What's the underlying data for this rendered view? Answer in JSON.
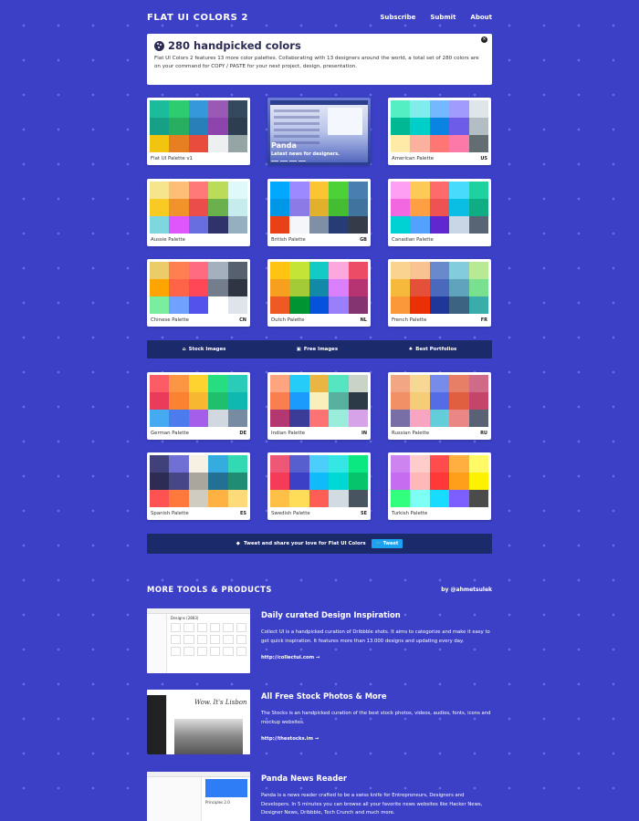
{
  "header": {
    "logo": "FLAT UI COLORS 2",
    "nav": [
      "Subscribe",
      "Submit",
      "About"
    ]
  },
  "intro": {
    "title": "280 handpicked colors",
    "text": "Flat UI Colors 2 features 13 more color palettes. Collaborating with 13 designers around the world, a total set of 280 colors are on your command for COPY / PASTE for your next project, design, presentation.",
    "close": "×"
  },
  "ad": {
    "title": "Panda",
    "subtitle": "Latest news for designers."
  },
  "palettes": [
    {
      "name": "Flat UI Palette v1",
      "flag": "",
      "colors": [
        "#1abc9c",
        "#2ecc71",
        "#3498db",
        "#9b59b6",
        "#34495e",
        "#16a085",
        "#27ae60",
        "#2980b9",
        "#8e44ad",
        "#2c3e50",
        "#f1c40f",
        "#e67e22",
        "#e74c3c",
        "#ecf0f1",
        "#95a5a6"
      ]
    },
    {
      "name": "American Palette",
      "flag": "US",
      "colors": [
        "#55efc4",
        "#81ecec",
        "#74b9ff",
        "#a29bfe",
        "#dfe6e9",
        "#00b894",
        "#00cec9",
        "#0984e3",
        "#6c5ce7",
        "#b2bec3",
        "#ffeaa7",
        "#fab1a0",
        "#ff7675",
        "#fd79a8",
        "#636e72"
      ]
    },
    {
      "name": "Aussie Palette",
      "flag": "",
      "colors": [
        "#f6e58d",
        "#ffbe76",
        "#ff7979",
        "#badc58",
        "#dff9fb",
        "#f9ca24",
        "#f0932b",
        "#eb4d4b",
        "#6ab04c",
        "#c7ecee",
        "#7ed6df",
        "#e056fd",
        "#686de0",
        "#30336b",
        "#95afc0"
      ]
    },
    {
      "name": "British Palette",
      "flag": "GB",
      "colors": [
        "#00a8ff",
        "#9c88ff",
        "#fbc531",
        "#4cd137",
        "#487eb0",
        "#0097e6",
        "#8c7ae6",
        "#e1b12c",
        "#44bd32",
        "#40739e",
        "#e84118",
        "#f5f6fa",
        "#7f8fa6",
        "#273c75",
        "#353b48"
      ]
    },
    {
      "name": "Canadian Palette",
      "flag": "",
      "colors": [
        "#ff9ff3",
        "#feca57",
        "#ff6b6b",
        "#48dbfb",
        "#1dd1a1",
        "#f368e0",
        "#ff9f43",
        "#ee5253",
        "#0abde3",
        "#10ac84",
        "#00d2d3",
        "#54a0ff",
        "#5f27cd",
        "#c8d6e5",
        "#576574"
      ]
    },
    {
      "name": "Chinese Palette",
      "flag": "CN",
      "colors": [
        "#eccc68",
        "#ff7f50",
        "#ff6b81",
        "#a4b0be",
        "#57606f",
        "#ffa502",
        "#ff6348",
        "#ff4757",
        "#747d8c",
        "#2f3542",
        "#7bed9f",
        "#70a1ff",
        "#5352ed",
        "#ffffff",
        "#dfe4ea"
      ]
    },
    {
      "name": "Dutch Palette",
      "flag": "NL",
      "colors": [
        "#ffc312",
        "#c4e538",
        "#12cbc4",
        "#fda7df",
        "#ed4c67",
        "#f79f1f",
        "#a3cb38",
        "#1289a7",
        "#d980fa",
        "#b53471",
        "#ee5a24",
        "#009432",
        "#0652dd",
        "#9980fa",
        "#833471"
      ]
    },
    {
      "name": "French Palette",
      "flag": "FR",
      "colors": [
        "#fad390",
        "#f8c291",
        "#6a89cc",
        "#82ccdd",
        "#b8e994",
        "#f6b93b",
        "#e55039",
        "#4a69bd",
        "#60a3bc",
        "#78e08f",
        "#fa983a",
        "#eb2f06",
        "#1e3799",
        "#3c6382",
        "#38ada9"
      ]
    },
    {
      "name": "German Palette",
      "flag": "DE",
      "colors": [
        "#fc5c65",
        "#fd9644",
        "#fed330",
        "#26de81",
        "#2bcbba",
        "#eb3b5a",
        "#fa8231",
        "#f7b731",
        "#20bf6b",
        "#0fb9b1",
        "#45aaf2",
        "#4b7bec",
        "#a55eea",
        "#d1d8e0",
        "#778ca3"
      ]
    },
    {
      "name": "Indian Palette",
      "flag": "IN",
      "colors": [
        "#fea47f",
        "#25ccf7",
        "#eab543",
        "#55e6c1",
        "#cad3c8",
        "#f97f51",
        "#1b9cfc",
        "#f8efba",
        "#58b19f",
        "#2c3a47",
        "#b33771",
        "#3b3b98",
        "#fd7272",
        "#9aecdb",
        "#d6a2e8"
      ]
    },
    {
      "name": "Russian Palette",
      "flag": "RU",
      "colors": [
        "#f3a683",
        "#f7d794",
        "#778beb",
        "#e77f67",
        "#cf6a87",
        "#f19066",
        "#f5cd79",
        "#546de5",
        "#e15f41",
        "#c44569",
        "#786fa6",
        "#f8a5c2",
        "#63cdda",
        "#ea8685",
        "#596275"
      ]
    },
    {
      "name": "Spanish Palette",
      "flag": "ES",
      "colors": [
        "#40407a",
        "#706fd3",
        "#f7f1e3",
        "#34ace0",
        "#33d9b2",
        "#2c2c54",
        "#474787",
        "#aaa69d",
        "#227093",
        "#218c74",
        "#ff5252",
        "#ff793f",
        "#d1ccc0",
        "#ffb142",
        "#ffda79"
      ]
    },
    {
      "name": "Swedish Palette",
      "flag": "SE",
      "colors": [
        "#ef5777",
        "#575fcf",
        "#4bcffa",
        "#34e7e4",
        "#0be881",
        "#f53b57",
        "#3c40c6",
        "#0fbcf9",
        "#00d8d6",
        "#05c46b",
        "#ffc048",
        "#ffdd59",
        "#ff5e57",
        "#d2dae2",
        "#485460"
      ]
    },
    {
      "name": "Turkish Palette",
      "flag": "",
      "colors": [
        "#cd84f1",
        "#ffcccc",
        "#ff4d4d",
        "#ffaf40",
        "#fffa65",
        "#c56cf0",
        "#ffb8b8",
        "#ff3838",
        "#ff9f1a",
        "#fff200",
        "#32ff7e",
        "#7efff5",
        "#18dcff",
        "#7d5fff",
        "#4b4b4b"
      ]
    }
  ],
  "banner": {
    "items": [
      "Stock Images",
      "Free Images",
      "Best Portfolios"
    ]
  },
  "tweet": {
    "text": "Tweet and share your love for Flat UI Colors",
    "button": "Tweet"
  },
  "tools": {
    "heading": "MORE TOOLS & PRODUCTS",
    "by": "by @ahmetsulek",
    "items": [
      {
        "title": "Daily curated Design Inspiration",
        "text": "Collect UI is a handpicked curation of Dribbble shots. It aims to categorize and make it easy to get quick inspiration. It features more than 13.000 designs and updating every day.",
        "link": "http://collectui.com →",
        "thumb_text": "Designs (2883)"
      },
      {
        "title": "All Free Stock Photos & More",
        "text": "The Stocks is an handpicked curation of the best stock photos, videos, audios, fonts, icons and mockup websites.",
        "link": "http://thestocks.im →",
        "thumb_text": "Wow. It's Lisbon"
      },
      {
        "title": "Panda News Reader",
        "text": "Panda is a news reader crafted to be a swiss knife for Entrepreneurs, Designers and Developers. In 5 minutes you can browse all your favorite news websites like Hacker News, Designer News, Dribbble, Tech Crunch and much more.",
        "link": "",
        "thumb_text": "Principles 2.0"
      }
    ]
  }
}
